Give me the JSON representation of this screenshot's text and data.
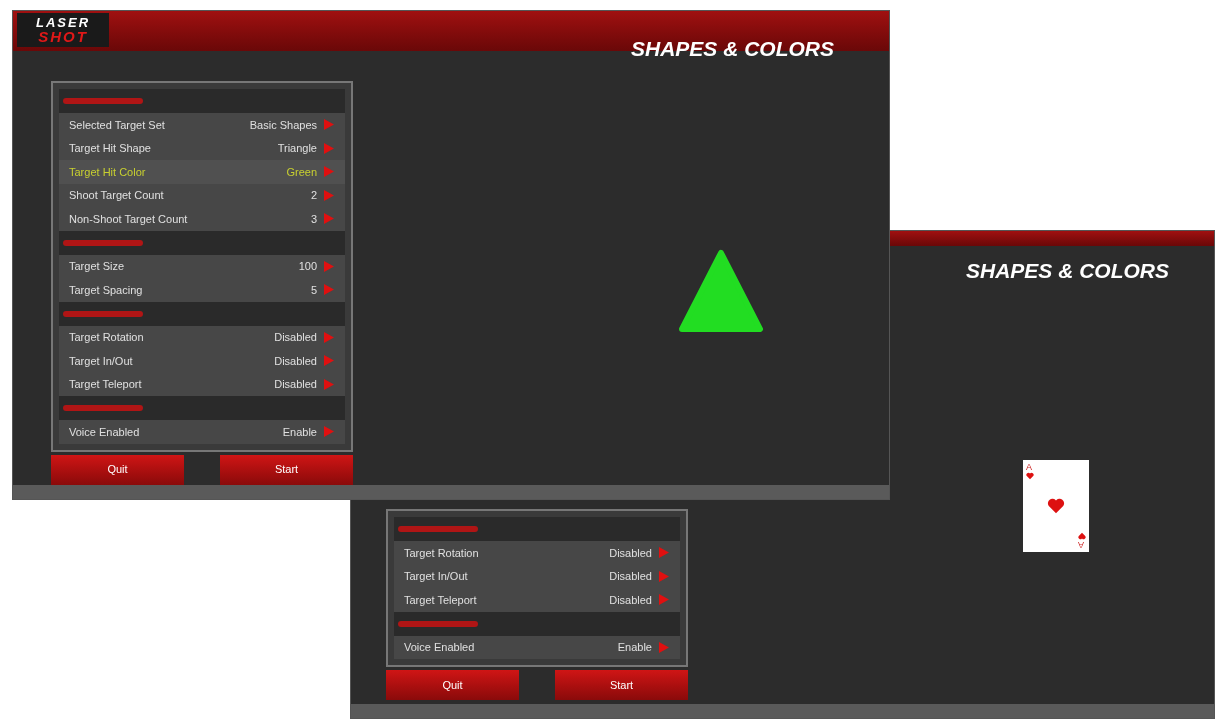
{
  "windows": [
    {
      "logo": {
        "line1": "LASER",
        "line2": "SHOT"
      },
      "title": "SHAPES & COLORS",
      "target": {
        "kind": "triangle",
        "color": "#22dd22"
      },
      "sections": [
        {
          "items": [
            {
              "label": "Selected Target Set",
              "value": "Basic Shapes",
              "selected": false
            },
            {
              "label": "Target Hit Shape",
              "value": "Triangle",
              "selected": false
            },
            {
              "label": "Target Hit Color",
              "value": "Green",
              "selected": true
            },
            {
              "label": "Shoot Target Count",
              "value": "2",
              "selected": false
            },
            {
              "label": "Non-Shoot Target Count",
              "value": "3",
              "selected": false
            }
          ]
        },
        {
          "items": [
            {
              "label": "Target Size",
              "value": "100",
              "selected": false
            },
            {
              "label": "Target Spacing",
              "value": "5",
              "selected": false
            }
          ]
        },
        {
          "items": [
            {
              "label": "Target Rotation",
              "value": "Disabled",
              "selected": false
            },
            {
              "label": "Target In/Out",
              "value": "Disabled",
              "selected": false
            },
            {
              "label": "Target Teleport",
              "value": "Disabled",
              "selected": false
            }
          ]
        },
        {
          "items": [
            {
              "label": "Voice Enabled",
              "value": "Enable",
              "selected": false
            }
          ]
        }
      ],
      "buttons": [
        "Quit",
        "Start"
      ]
    },
    {
      "title": "SHAPES & COLORS",
      "target": {
        "kind": "card",
        "rank_top": "A",
        "rank_bottom": "A"
      },
      "sections": [
        {
          "items": [
            {
              "label": "Target Rotation",
              "value": "Disabled",
              "selected": false
            },
            {
              "label": "Target In/Out",
              "value": "Disabled",
              "selected": false
            },
            {
              "label": "Target Teleport",
              "value": "Disabled",
              "selected": false
            }
          ]
        },
        {
          "items": [
            {
              "label": "Voice Enabled",
              "value": "Enable",
              "selected": false
            }
          ]
        }
      ],
      "buttons": [
        "Quit",
        "Start"
      ]
    }
  ]
}
